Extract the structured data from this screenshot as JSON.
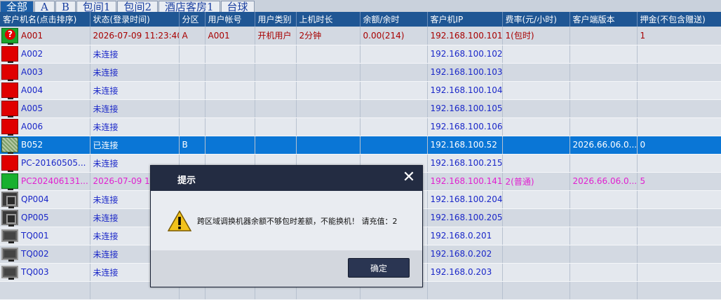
{
  "tabs": [
    "全部",
    "A",
    "B",
    "包间1",
    "包间2",
    "酒店客房1",
    "台球"
  ],
  "headers": [
    "客户机名(点击排序)",
    "状态(登录时间)",
    "分区",
    "用户帐号",
    "用户类别",
    "上机时长",
    "余额/余时",
    "客户机IP",
    "费率(元/小时)",
    "客户端版本",
    "押金(不包含赠送)"
  ],
  "rows": [
    {
      "icon": "q",
      "style": "r-online",
      "name": "A001",
      "status": "2026-07-09 11:23:40",
      "zone": "A",
      "account": "A001",
      "category": "开机用户",
      "duration": "2分钟",
      "balance": "0.00(214)",
      "ip": "192.168.100.101",
      "rate": "1(包时)",
      "version": "",
      "deposit": "1"
    },
    {
      "icon": "red",
      "style": "",
      "name": "A002",
      "status": "未连接",
      "zone": "",
      "account": "",
      "category": "",
      "duration": "",
      "balance": "",
      "ip": "192.168.100.102",
      "rate": "",
      "version": "",
      "deposit": ""
    },
    {
      "icon": "red",
      "style": "",
      "name": "A003",
      "status": "未连接",
      "zone": "",
      "account": "",
      "category": "",
      "duration": "",
      "balance": "",
      "ip": "192.168.100.103",
      "rate": "",
      "version": "",
      "deposit": ""
    },
    {
      "icon": "red",
      "style": "",
      "name": "A004",
      "status": "未连接",
      "zone": "",
      "account": "",
      "category": "",
      "duration": "",
      "balance": "",
      "ip": "192.168.100.104",
      "rate": "",
      "version": "",
      "deposit": ""
    },
    {
      "icon": "red",
      "style": "",
      "name": "A005",
      "status": "未连接",
      "zone": "",
      "account": "",
      "category": "",
      "duration": "",
      "balance": "",
      "ip": "192.168.100.105",
      "rate": "",
      "version": "",
      "deposit": ""
    },
    {
      "icon": "red",
      "style": "",
      "name": "A006",
      "status": "未连接",
      "zone": "",
      "account": "",
      "category": "",
      "duration": "",
      "balance": "",
      "ip": "192.168.100.106",
      "rate": "",
      "version": "",
      "deposit": ""
    },
    {
      "icon": "pattern",
      "style": "r-selected",
      "name": "B052",
      "status": "已连接",
      "zone": "B",
      "account": "",
      "category": "",
      "duration": "",
      "balance": "",
      "ip": "192.168.100.52",
      "rate": "",
      "version": "2026.66.06.0...",
      "deposit": "0"
    },
    {
      "icon": "red",
      "style": "",
      "name": "PC-20160505...",
      "status": "未连接",
      "zone": "",
      "account": "",
      "category": "",
      "duration": "",
      "balance": "",
      "ip": "192.168.100.215",
      "rate": "",
      "version": "",
      "deposit": ""
    },
    {
      "icon": "green",
      "style": "r-pink",
      "name": "PC202406131...",
      "status": "2026-07-09 11",
      "zone": "",
      "account": "",
      "category": "",
      "duration": "",
      "balance": "",
      "ip": "192.168.100.141",
      "rate": "2(普通)",
      "version": "2026.66.06.0...",
      "deposit": "5"
    },
    {
      "icon": "dark",
      "style": "",
      "name": "QP004",
      "status": "未连接",
      "zone": "",
      "account": "",
      "category": "",
      "duration": "",
      "balance": "",
      "ip": "192.168.100.204",
      "rate": "",
      "version": "",
      "deposit": ""
    },
    {
      "icon": "dark",
      "style": "",
      "name": "QP005",
      "status": "未连接",
      "zone": "",
      "account": "",
      "category": "",
      "duration": "",
      "balance": "",
      "ip": "192.168.100.205",
      "rate": "",
      "version": "",
      "deposit": ""
    },
    {
      "icon": "grey",
      "style": "",
      "name": "TQ001",
      "status": "未连接",
      "zone": "",
      "account": "",
      "category": "",
      "duration": "",
      "balance": "",
      "ip": "192.168.0.201",
      "rate": "",
      "version": "",
      "deposit": ""
    },
    {
      "icon": "grey",
      "style": "",
      "name": "TQ002",
      "status": "未连接",
      "zone": "",
      "account": "",
      "category": "",
      "duration": "",
      "balance": "",
      "ip": "192.168.0.202",
      "rate": "",
      "version": "",
      "deposit": ""
    },
    {
      "icon": "grey",
      "style": "",
      "name": "TQ003",
      "status": "未连接",
      "zone": "",
      "account": "",
      "category": "",
      "duration": "",
      "balance": "",
      "ip": "192.168.0.203",
      "rate": "",
      "version": "",
      "deposit": ""
    },
    {
      "icon": "grey",
      "style": "",
      "name": "",
      "status": "",
      "zone": "",
      "account": "",
      "category": "",
      "duration": "",
      "balance": "",
      "ip": "",
      "rate": "",
      "version": "",
      "deposit": ""
    }
  ],
  "dialog": {
    "title": "提示",
    "message": "跨区域调换机器余额不够包时差额，不能换机！ 请充值：2",
    "ok_label": "确定",
    "icon": "warning-icon",
    "close_icon": "close-icon"
  },
  "colors": {
    "header_bg": "#1f5694",
    "selected_row": "#0a76d6",
    "online_text": "#a80000",
    "link_text": "#1a27c8",
    "pink_text": "#e020d0",
    "dialog_header": "#232c42"
  }
}
